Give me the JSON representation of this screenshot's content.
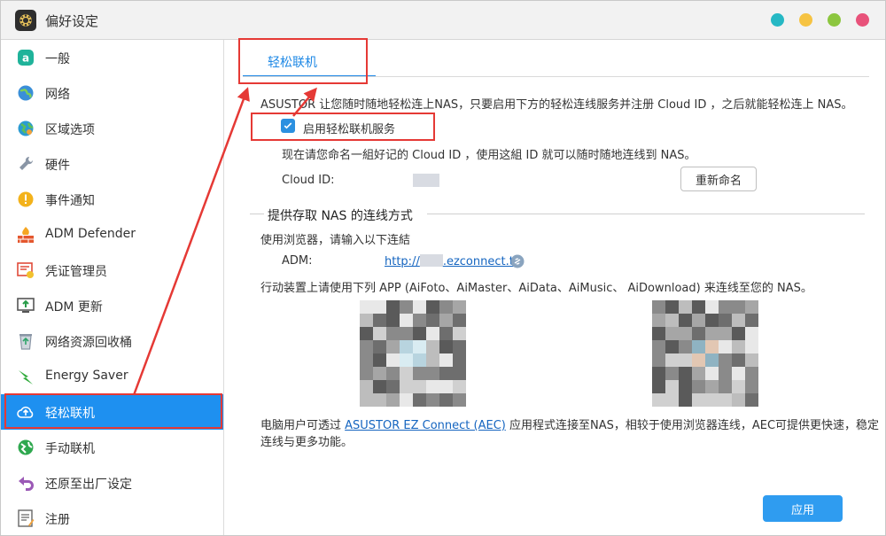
{
  "window": {
    "title": "偏好设定"
  },
  "colors": {
    "accent": "#1e90f0",
    "annotation": "#e53935",
    "btn_teal": "#26b8c4",
    "btn_yellow": "#f6c342",
    "btn_green": "#8cc63f",
    "btn_pink": "#e8527a"
  },
  "sidebar": {
    "items": [
      {
        "label": "一般",
        "icon": "general-icon"
      },
      {
        "label": "网络",
        "icon": "globe-icon"
      },
      {
        "label": "区域选项",
        "icon": "region-icon"
      },
      {
        "label": "硬件",
        "icon": "hardware-icon"
      },
      {
        "label": "事件通知",
        "icon": "notification-icon"
      },
      {
        "label": "ADM Defender",
        "icon": "firewall-icon"
      },
      {
        "label": "凭证管理员",
        "icon": "certificate-icon"
      },
      {
        "label": "ADM 更新",
        "icon": "update-icon"
      },
      {
        "label": "网络资源回收桶",
        "icon": "recycle-bin-icon"
      },
      {
        "label": "Energy Saver",
        "icon": "energy-icon"
      },
      {
        "label": "轻松联机",
        "icon": "cloud-icon"
      },
      {
        "label": "手动联机",
        "icon": "manual-connect-icon"
      },
      {
        "label": "还原至出厂设定",
        "icon": "restore-icon"
      },
      {
        "label": "注册",
        "icon": "register-icon"
      }
    ],
    "active_index": 10
  },
  "main": {
    "tab_label": "轻松联机",
    "intro": "ASUSTOR 让您随时随地轻松连上NAS，只要启用下方的轻松连线服务并注册 Cloud ID ，之后就能轻松连上 NAS。",
    "enable_label": "启用轻松联机服务",
    "enable_checked": true,
    "name_hint": "现在请您命名一組好记的 Cloud ID ，使用这組 ID 就可以随时随地连线到 NAS。",
    "cloud_id_label": "Cloud ID:",
    "rename_button": "重新命名",
    "section_title": "提供存取 NAS 的连线方式",
    "browser_hint": "使用浏览器，请输入以下连結",
    "adm_label": "ADM:",
    "adm_link_prefix": "http://",
    "adm_link_suffix": ".ezconnect.to",
    "mobile_hint": "行动装置上请使用下列 APP  (AiFoto、AiMaster、AiData、AiMusic、 AiDownload) 来连线至您的 NAS。",
    "pc_hint_prefix": "电脑用户可透过 ",
    "pc_hint_link": "ASUSTOR EZ Connect (AEC)",
    "pc_hint_suffix": " 应用程式连接至NAS，相较于使用浏览器连线，AEC可提供更快速，稳定",
    "pc_hint_line2": "连线与更多功能。",
    "apply_button": "应用"
  }
}
